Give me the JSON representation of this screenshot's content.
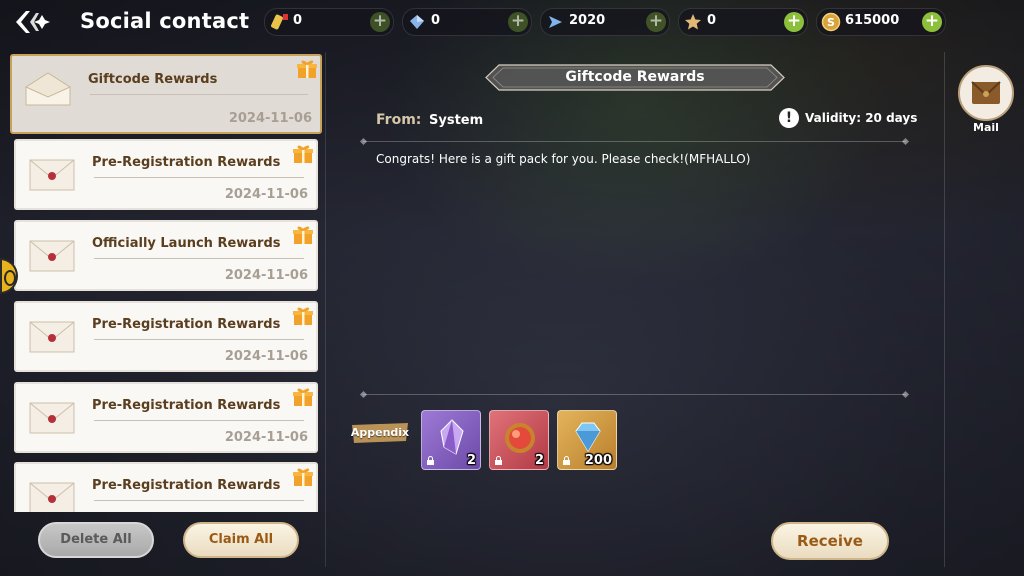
{
  "header": {
    "title": "Social contact",
    "currencies": [
      {
        "icon": "ticket-icon",
        "value": "0"
      },
      {
        "icon": "crystal-icon",
        "value": "0"
      },
      {
        "icon": "arrow-token-icon",
        "value": "2020"
      },
      {
        "icon": "star-icon",
        "value": "0"
      },
      {
        "icon": "coin-icon",
        "value": "615000"
      }
    ]
  },
  "mail_list": [
    {
      "title": "Giftcode Rewards",
      "date": "2024-11-06",
      "selected": true
    },
    {
      "title": "Pre-Registration Rewards",
      "date": "2024-11-06"
    },
    {
      "title": "Officially Launch Rewards",
      "date": "2024-11-06"
    },
    {
      "title": "Pre-Registration Rewards",
      "date": "2024-11-06"
    },
    {
      "title": "Pre-Registration Rewards",
      "date": "2024-11-06"
    },
    {
      "title": "Pre-Registration Rewards",
      "date": ""
    }
  ],
  "buttons": {
    "delete_all": "Delete All",
    "claim_all": "Claim All",
    "receive": "Receive"
  },
  "detail": {
    "title": "Giftcode Rewards",
    "from_label": "From:",
    "from_value": "System",
    "validity": "Validity: 20 days",
    "message": "Congrats! Here is a gift pack for you. Please check!(MFHALLO)",
    "appendix_label": "Appendix",
    "rewards": [
      {
        "icon": "purple-crystal-icon",
        "qty": "2"
      },
      {
        "icon": "red-orb-icon",
        "qty": "2"
      },
      {
        "icon": "blue-diamond-icon",
        "qty": "200"
      }
    ]
  },
  "side_tab": {
    "label": "Mail",
    "icon": "mail-icon"
  }
}
